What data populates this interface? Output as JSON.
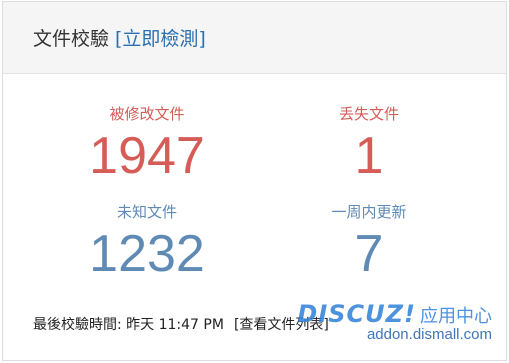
{
  "header": {
    "title": "文件校驗",
    "check_link": "[立即檢測]"
  },
  "stats": {
    "modified": {
      "label": "被修改文件",
      "value": "1947"
    },
    "lost": {
      "label": "丢失文件",
      "value": "1"
    },
    "unknown": {
      "label": "未知文件",
      "value": "1232"
    },
    "updated": {
      "label": "一周内更新",
      "value": "7"
    }
  },
  "footer": {
    "last_check_label": "最後校驗時間: 昨天 11:47 PM",
    "view_list_link": "[查看文件列表]"
  },
  "watermark": {
    "brand": "DISCUZ!",
    "brand_cn": "应用中心",
    "domain": "addon.dismall.com"
  },
  "colors": {
    "red_stat": "#d65c57",
    "blue_stat": "#5f8ab3",
    "link": "#2a6fb0"
  }
}
